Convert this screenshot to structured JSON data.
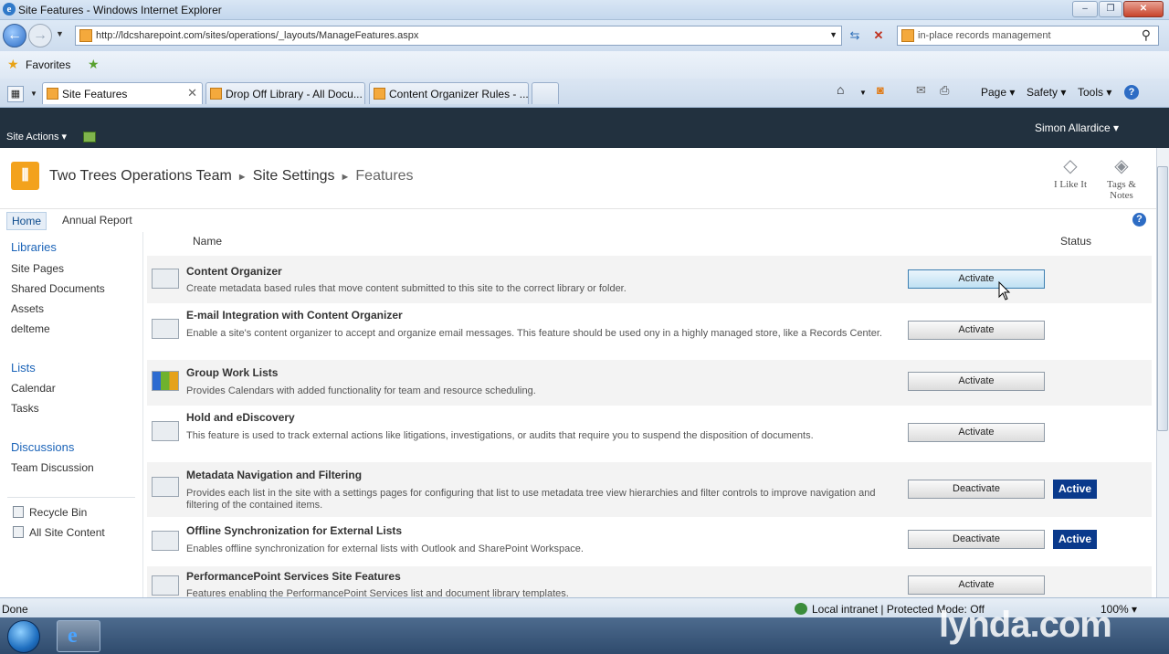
{
  "window": {
    "title": "Site Features - Windows Internet Explorer",
    "min": "–",
    "max": "❐",
    "close": "✕"
  },
  "browser": {
    "url": "http://ldcsharepoint.com/sites/operations/_layouts/ManageFeatures.aspx",
    "search_text": "in-place records management",
    "favorites_label": "Favorites",
    "tabs": [
      {
        "label": "Site Features",
        "active": true
      },
      {
        "label": "Drop Off Library - All Docu...",
        "active": false
      },
      {
        "label": "Content Organizer Rules - ...",
        "active": false
      }
    ],
    "commands": {
      "page": "Page ▾",
      "safety": "Safety ▾",
      "tools": "Tools ▾",
      "help": "?"
    }
  },
  "ribbon": {
    "site_actions": "Site Actions ▾",
    "user": "Simon Allardice ▾"
  },
  "breadcrumb": {
    "site": "Two Trees Operations Team",
    "settings": "Site Settings",
    "current": "Features"
  },
  "header_tools": {
    "like": "I Like It",
    "tags": "Tags &",
    "notes": "Notes"
  },
  "topnav": {
    "home": "Home",
    "annual_report": "Annual Report"
  },
  "quicklaunch": {
    "libraries": "Libraries",
    "library_items": [
      "Site Pages",
      "Shared Documents",
      "Assets",
      "delteme"
    ],
    "lists": "Lists",
    "list_items": [
      "Calendar",
      "Tasks"
    ],
    "discussions": "Discussions",
    "discussion_items": [
      "Team Discussion"
    ],
    "recycle_bin": "Recycle Bin",
    "all_site_content": "All Site Content"
  },
  "features": {
    "col_name": "Name",
    "col_status": "Status",
    "items": [
      {
        "title": "Content Organizer",
        "desc": "Create metadata based rules that move content submitted to this site to the correct library or folder.",
        "button": "Activate",
        "status": ""
      },
      {
        "title": "E-mail Integration with Content Organizer",
        "desc": "Enable a site's content organizer to accept and organize email messages. This feature should be used ony in a highly managed store, like a Records Center.",
        "button": "Activate",
        "status": ""
      },
      {
        "title": "Group Work Lists",
        "desc": "Provides Calendars with added functionality for team and resource scheduling.",
        "button": "Activate",
        "status": ""
      },
      {
        "title": "Hold and eDiscovery",
        "desc": "This feature is used to track external actions like litigations, investigations, or audits that require you to suspend the disposition of documents.",
        "button": "Activate",
        "status": ""
      },
      {
        "title": "Metadata Navigation and Filtering",
        "desc": "Provides each list in the site with a settings pages for configuring that list to use metadata tree view hierarchies and filter controls to improve navigation and filtering of the contained items.",
        "button": "Deactivate",
        "status": "Active"
      },
      {
        "title": "Offline Synchronization for External Lists",
        "desc": "Enables offline synchronization for external lists with Outlook and SharePoint Workspace.",
        "button": "Deactivate",
        "status": "Active"
      },
      {
        "title": "PerformancePoint Services Site Features",
        "desc": "Features enabling the PerformancePoint Services list and document library templates.",
        "button": "Activate",
        "status": ""
      }
    ]
  },
  "statusbar": {
    "left": "Done",
    "zone": "Local intranet | Protected Mode: Off",
    "zoom": "100% ▾"
  },
  "watermark": "lynda.com",
  "icons": {
    "start": "windows-orb",
    "ie": "ie-logo"
  }
}
